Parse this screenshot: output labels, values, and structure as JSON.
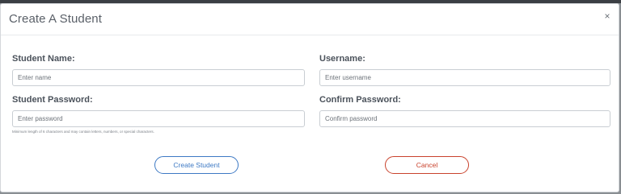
{
  "modal": {
    "title": "Create A Student",
    "close_glyph": "×"
  },
  "fields": {
    "student_name": {
      "label": "Student Name:",
      "placeholder": "Enter name",
      "value": ""
    },
    "username": {
      "label": "Username:",
      "placeholder": "Enter username",
      "value": ""
    },
    "student_password": {
      "label": "Student Password:",
      "placeholder": "Enter password",
      "value": "",
      "hint": "Minimum length of 6 characters and may contain letters, numbers, or special characters."
    },
    "confirm_password": {
      "label": "Confirm Password:",
      "placeholder": "Confirm password",
      "value": ""
    }
  },
  "buttons": {
    "create_label": "Create Student",
    "cancel_label": "Cancel"
  },
  "colors": {
    "primary": "#3d79c4",
    "danger": "#c9422c",
    "label": "#4b525b",
    "title": "#5a6068"
  },
  "icons": {
    "close": "close-icon"
  }
}
